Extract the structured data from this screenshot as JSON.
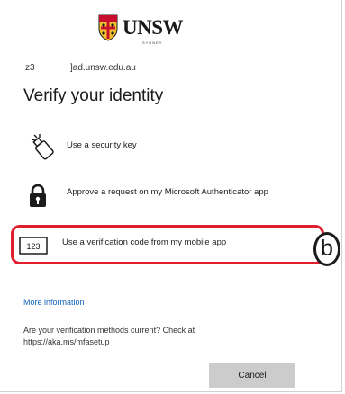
{
  "brand": {
    "logo_text": "UNSW",
    "logo_subtext": "SYDNEY"
  },
  "account": {
    "prefix": "z3",
    "domain": "]ad.unsw.edu.au"
  },
  "page": {
    "title": "Verify your identity"
  },
  "options": [
    {
      "label": "Use a security key",
      "icon": "security-key-icon"
    },
    {
      "label": "Approve a request on my Microsoft Authenticator app",
      "icon": "lock-icon"
    },
    {
      "label": "Use a verification code from my mobile app",
      "icon": "code-123-icon",
      "icon_text": "123"
    }
  ],
  "annotation": {
    "label": "b",
    "color": "#e01e2e"
  },
  "more_info": "More information",
  "question_line1": "Are your verification methods current? Check at",
  "question_line2": "https://aka.ms/mfasetup",
  "cancel_label": "Cancel",
  "colors": {
    "link": "#0f62b8",
    "highlight": "#e01e2e",
    "button": "#cccccc"
  }
}
